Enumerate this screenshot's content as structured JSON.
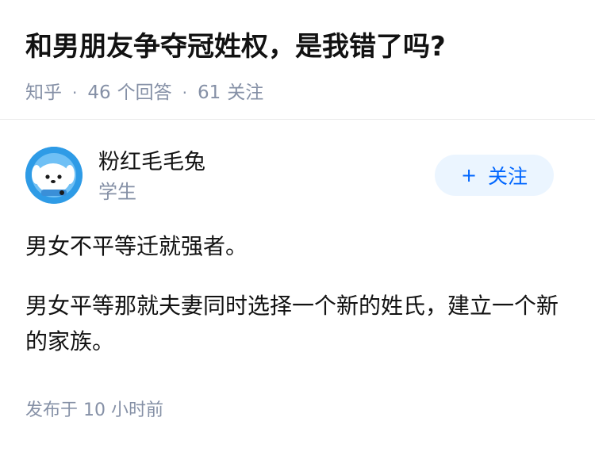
{
  "question": {
    "title": "和男朋友争夺冠姓权，是我错了吗?",
    "source": "知乎",
    "answer_count": "46",
    "answer_label": "个回答",
    "follower_count": "61",
    "follower_label": "关注"
  },
  "author": {
    "name": "粉红毛毛兔",
    "bio": "学生",
    "avatar_icon": "avatar-cartoon-icon",
    "follow_label": "关注",
    "follow_icon": "plus-icon",
    "follow_color": "#0066ff"
  },
  "answer": {
    "paragraphs": [
      "男女不平等迁就强者。",
      "男女平等那就夫妻同时选择一个新的姓氏，建立一个新的家族。"
    ],
    "time_prefix": "发布于",
    "time_value": "10 小时前"
  },
  "colors": {
    "title": "#121212",
    "meta": "#8590a6",
    "follow_bg": "#ebf5ff",
    "divider": "#ebebeb"
  }
}
